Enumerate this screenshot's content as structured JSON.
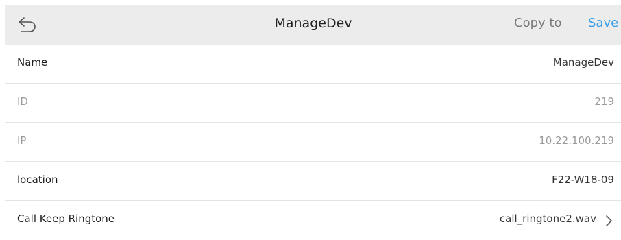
{
  "header": {
    "title": "ManageDev",
    "copy_label": "Copy to",
    "save_label": "Save",
    "back_icon": "back-arrow-icon",
    "accent_color": "#3a9ee8"
  },
  "rows": [
    {
      "label": "Name",
      "value": "ManageDev"
    },
    {
      "label": "ID",
      "value": "219"
    },
    {
      "label": "IP",
      "value": "10.22.100.219"
    },
    {
      "label": "location",
      "value": "F22-W18-09"
    },
    {
      "label": "Call Keep Ringtone",
      "value": "call_ringtone2.wav",
      "icon": "chevron-right-icon"
    }
  ]
}
